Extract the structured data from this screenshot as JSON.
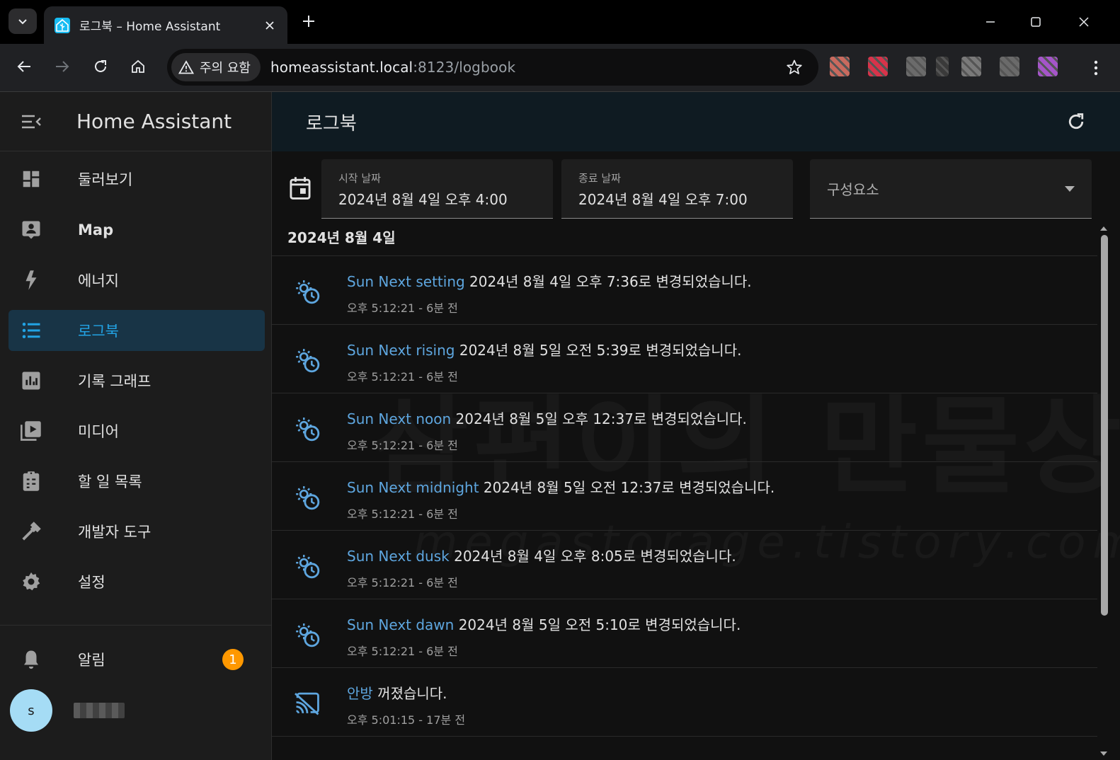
{
  "browser": {
    "tab_title": "로그북 – Home Assistant",
    "security_label": "주의 요함",
    "url_host": "homeassistant.local",
    "url_rest": ":8123/logbook",
    "extension_colors": [
      "#c96a5e",
      "#d8334a",
      "#6b6b6b",
      "#3a3a3a",
      "#7a7a7a",
      "#6a6a6a",
      "#a555c9"
    ]
  },
  "sidebar": {
    "title": "Home Assistant",
    "items": [
      {
        "label": "둘러보기",
        "icon": "dashboard-icon"
      },
      {
        "label": "Map",
        "icon": "map-account-icon"
      },
      {
        "label": "에너지",
        "icon": "lightning-icon"
      },
      {
        "label": "로그북",
        "icon": "format-list-icon"
      },
      {
        "label": "기록 그래프",
        "icon": "chart-box-icon"
      },
      {
        "label": "미디어",
        "icon": "play-box-icon"
      },
      {
        "label": "할 일 목록",
        "icon": "clipboard-list-icon"
      },
      {
        "label": "개발자 도구",
        "icon": "hammer-icon"
      },
      {
        "label": "설정",
        "icon": "cog-icon"
      }
    ],
    "notifications_label": "알림",
    "notifications_count": "1",
    "user_initial": "s"
  },
  "main": {
    "title": "로그북",
    "start_label": "시작 날짜",
    "start_value": "2024년 8월 4일 오후 4:00",
    "end_label": "종료 날짜",
    "end_value": "2024년 8월 4일 오후 7:00",
    "entity_placeholder": "구성요소",
    "date_heading": "2024년 8월 4일",
    "entries": [
      {
        "entity": "Sun Next setting",
        "text": " 2024년 8월 4일 오후 7:36로 변경되었습니다.",
        "time": "오후 5:12:21 - 6분 전",
        "icon": "sun-clock-icon"
      },
      {
        "entity": "Sun Next rising",
        "text": " 2024년 8월 5일 오전 5:39로 변경되었습니다.",
        "time": "오후 5:12:21 - 6분 전",
        "icon": "sun-clock-icon"
      },
      {
        "entity": "Sun Next noon",
        "text": " 2024년 8월 5일 오후 12:37로 변경되었습니다.",
        "time": "오후 5:12:21 - 6분 전",
        "icon": "sun-clock-icon"
      },
      {
        "entity": "Sun Next midnight",
        "text": " 2024년 8월 5일 오전 12:37로 변경되었습니다.",
        "time": "오후 5:12:21 - 6분 전",
        "icon": "sun-clock-icon"
      },
      {
        "entity": "Sun Next dusk",
        "text": " 2024년 8월 4일 오후 8:05로 변경되었습니다.",
        "time": "오후 5:12:21 - 6분 전",
        "icon": "sun-clock-icon"
      },
      {
        "entity": "Sun Next dawn",
        "text": " 2024년 8월 5일 오전 5:10로 변경되었습니다.",
        "time": "오후 5:12:21 - 6분 전",
        "icon": "sun-clock-icon"
      },
      {
        "entity": "안방",
        "text": " 꺼졌습니다.",
        "time": "오후 5:01:15 - 17분 전",
        "icon": "cast-off-icon"
      }
    ]
  },
  "watermark": {
    "line1": "삼편이의 만물상",
    "line2": "megastorage.tistory.com"
  }
}
